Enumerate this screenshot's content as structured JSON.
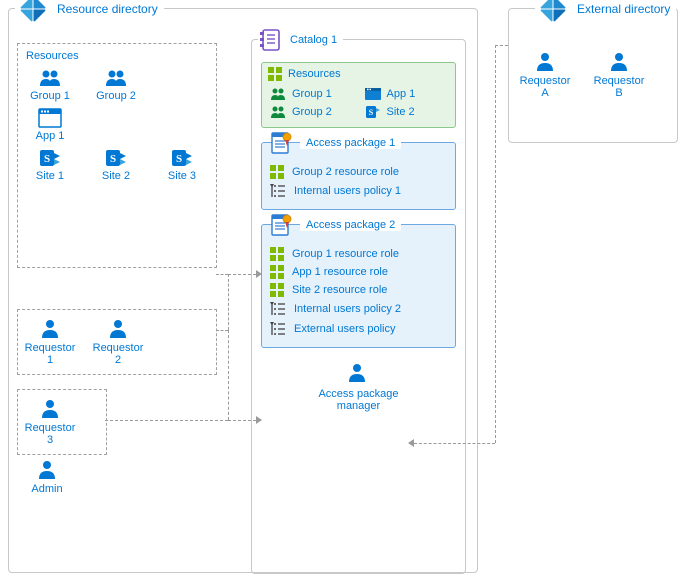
{
  "resourceDirectory": {
    "title": "Resource directory",
    "resourcesLabel": "Resources",
    "resources": {
      "group1": "Group 1",
      "group2": "Group 2",
      "app1": "App 1",
      "site1": "Site 1",
      "site2": "Site 2",
      "site3": "Site 3"
    },
    "requestors": {
      "r1": "Requestor 1",
      "r2": "Requestor 2",
      "r3": "Requestor 3"
    },
    "admin": "Admin",
    "catalog": {
      "title": "Catalog 1",
      "resourcesTitle": "Resources",
      "resources": {
        "group1": "Group 1",
        "group2": "Group 2",
        "app1": "App 1",
        "site2": "Site 2"
      },
      "package1": {
        "title": "Access package 1",
        "role1": "Group 2 resource role",
        "policy1": "Internal users policy 1"
      },
      "package2": {
        "title": "Access package 2",
        "role1": "Group 1 resource role",
        "role2": "App 1 resource role",
        "role3": "Site 2 resource role",
        "policy1": "Internal users policy 2",
        "policy2": "External users policy"
      },
      "manager": "Access package\nmanager"
    }
  },
  "externalDirectory": {
    "title": "External directory",
    "requestors": {
      "a": "Requestor A",
      "b": "Requestor B"
    }
  }
}
